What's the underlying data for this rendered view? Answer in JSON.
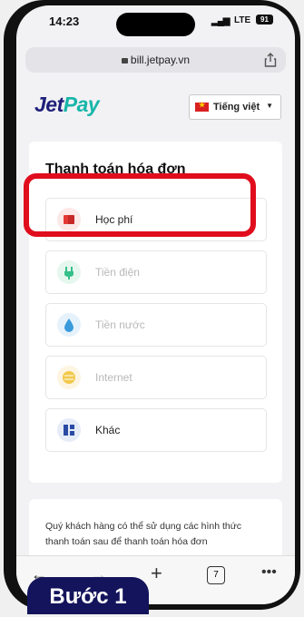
{
  "status_bar": {
    "time": "14:23",
    "network": "LTE",
    "battery": "91"
  },
  "browser": {
    "url": "bill.jetpay.vn"
  },
  "header": {
    "logo_part1": "Jet",
    "logo_part2": "Pay",
    "language": "Tiếng việt"
  },
  "payment": {
    "title": "Thanh toán hóa đơn",
    "items": [
      {
        "label": "Học phí",
        "state": "active",
        "icon": "tuition-icon",
        "icon_bg": "#fde8e8",
        "icon_color": "#e53935"
      },
      {
        "label": "Tiền điện",
        "state": "disabled",
        "icon": "plug-icon",
        "icon_bg": "#e6f7ef",
        "icon_color": "#35c08a"
      },
      {
        "label": "Tiền nước",
        "state": "disabled",
        "icon": "water-drop-icon",
        "icon_bg": "#e6f2fb",
        "icon_color": "#3a9bdc"
      },
      {
        "label": "Internet",
        "state": "disabled",
        "icon": "wifi-icon",
        "icon_bg": "#fdf5e2",
        "icon_color": "#f2c94c"
      },
      {
        "label": "Khác",
        "state": "active",
        "icon": "grid-icon",
        "icon_bg": "#e6ecf8",
        "icon_color": "#2b4ba3"
      }
    ]
  },
  "info": {
    "text": "Quý khách hàng có thể sử dụng các hình thức thanh toán sau để thanh toán hóa đơn"
  },
  "toolbar": {
    "tabs_count": "7"
  },
  "step_badge": {
    "label": "Bước 1"
  },
  "colors": {
    "highlight": "#e00d1d",
    "brand_dark": "#1f1f7a",
    "brand_teal": "#17b6a9",
    "badge_bg": "#14145c"
  }
}
